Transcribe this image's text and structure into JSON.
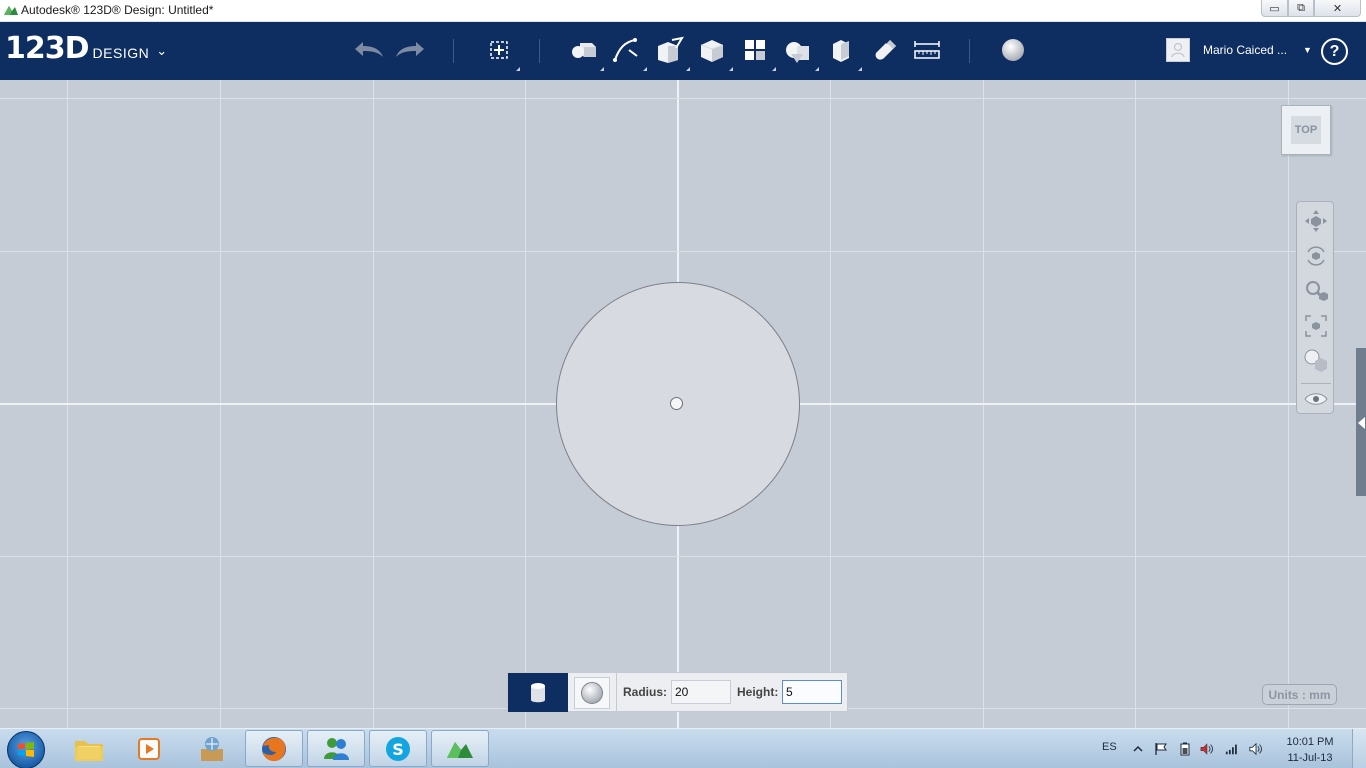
{
  "window": {
    "title": "Autodesk® 123D® Design: Untitled*",
    "minimize_glyph": "▭",
    "maximize_glyph": "⧉",
    "close_glyph": "✕"
  },
  "app": {
    "logo_main": "123D",
    "logo_sub": "DESIGN",
    "logo_caret": "⌄",
    "user_name": "Mario Caiced ...",
    "user_caret": "▼",
    "help_glyph": "?"
  },
  "toolbar": {
    "tools": [
      "undo",
      "redo",
      "transform",
      "primitives",
      "sketch",
      "construct",
      "modify",
      "pattern",
      "group",
      "combine",
      "snap",
      "measure",
      "material"
    ]
  },
  "viewport": {
    "viewcube_label": "TOP",
    "nav_tools": [
      "pan",
      "orbit",
      "zoom",
      "fit",
      "view-style",
      "visibility"
    ],
    "units_label": "Units : mm",
    "shape": "cylinder"
  },
  "shape_panel": {
    "radius_label": "Radius:",
    "radius_value": "20",
    "height_label": "Height:",
    "height_value": "5"
  },
  "taskbar": {
    "apps": [
      "windows-explorer",
      "media-player",
      "games-folder",
      "firefox",
      "windows-live-messenger",
      "skype",
      "123d-design"
    ],
    "language": "ES",
    "time": "10:01 PM",
    "date": "11-Jul-13"
  },
  "colors": {
    "toolbar_bg": "#0e2d61",
    "viewport_bg": "#c5ccd5",
    "grid_line": "#dce1e8",
    "disk_fill": "#d8dae2"
  }
}
